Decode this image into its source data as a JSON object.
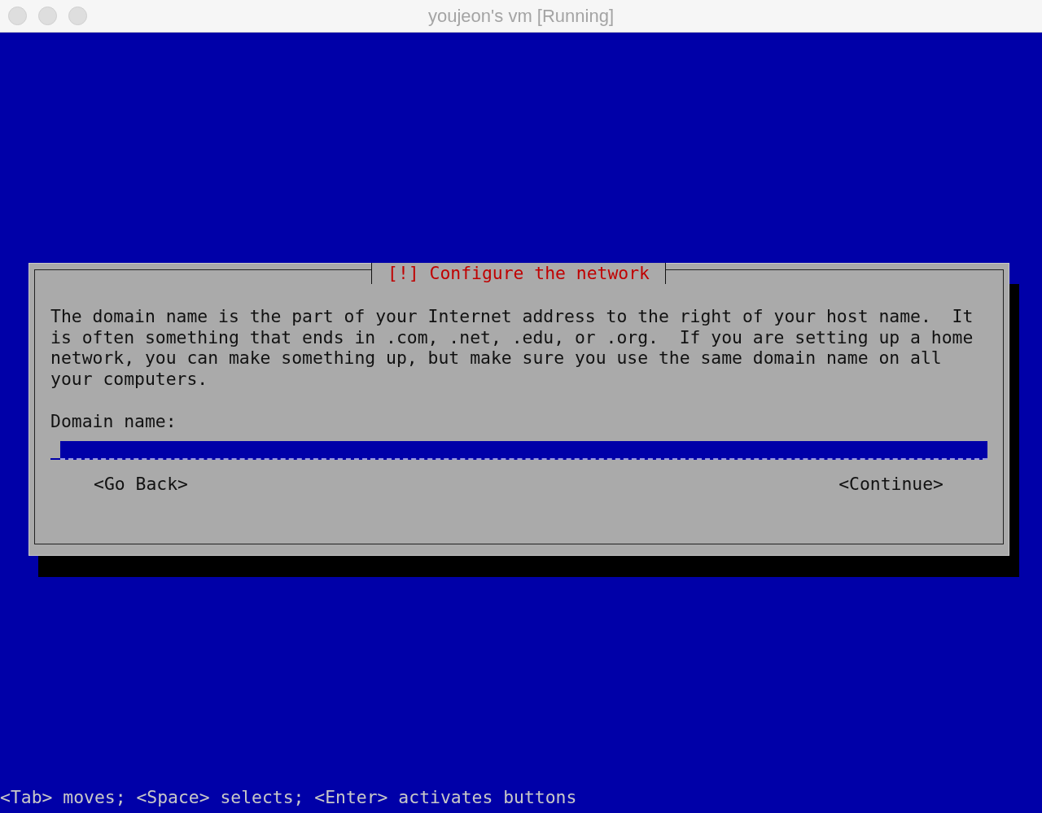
{
  "window": {
    "title": "youjeon's vm [Running]"
  },
  "dialog": {
    "title": "[!] Configure the network",
    "message": "The domain name is the part of your Internet address to the right of your host name.  It\nis often something that ends in .com, .net, .edu, or .org.  If you are setting up a home\nnetwork, you can make something up, but make sure you use the same domain name on all\nyour computers.",
    "field": {
      "label": "Domain name:"
    },
    "buttons": [
      "<Go Back>",
      "<Continue>"
    ]
  },
  "status_bar": {
    "text": "<Tab> moves; <Space> selects; <Enter> activates buttons"
  }
}
